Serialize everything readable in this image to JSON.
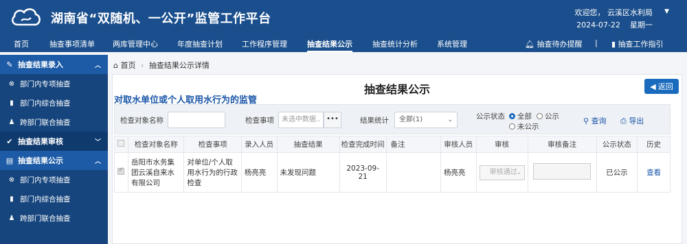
{
  "app": {
    "title": "湖南省“双随机、一公开”监管工作平台"
  },
  "user": {
    "greeting": "欢迎您， 云溪区水利局",
    "date_line": "2024-07-22    星期一"
  },
  "nav": {
    "items": [
      "首页",
      "抽查事项清单",
      "两库管理中心",
      "年度抽查计划",
      "工作程序管理",
      "抽查结果公示",
      "抽查统计分析",
      "系统管理"
    ],
    "right": [
      "抽查待办提醒",
      "抽查工作指引"
    ]
  },
  "sidebar": {
    "groups": [
      {
        "label": "抽查结果录入",
        "items": [
          "部门内专项抽查",
          "部门内综合抽查",
          "跨部门联合抽查"
        ]
      },
      {
        "label": "抽查结果审核"
      },
      {
        "label": "抽查结果公示",
        "items": [
          "部门内专项抽查",
          "部门内综合抽查",
          "跨部门联合抽查"
        ]
      }
    ]
  },
  "breadcrumb": {
    "home": "首页",
    "current": "抽查结果公示详情"
  },
  "page": {
    "title": "抽查结果公示",
    "subtitle": "对取水单位或个人取用水行为的监管",
    "back": "返回"
  },
  "filter": {
    "object_label": "检查对象名称",
    "object_value": "",
    "item_label": "检查事项",
    "item_placeholder": "未选中数据..",
    "item_btn": "•••",
    "stat_label": "结果统计",
    "stat_value": "全部(1)",
    "status_label": "公示状态",
    "status_options": [
      "全部",
      "公示",
      "未公示"
    ],
    "query": "查询",
    "export": "导出"
  },
  "table": {
    "headers": [
      "检查对象名称",
      "检查事项",
      "录入人员",
      "抽查结果",
      "检查完成时间",
      "备注",
      "审核人员",
      "审核",
      "审核备注",
      "公示状态",
      "历史"
    ],
    "rows": [
      {
        "object": "岳阳市水务集团云溪自来水有限公司",
        "item": "对单位/个人取用水行为的行政检查",
        "entry": "杨亮亮",
        "result": "未发现问题",
        "finish": "2023-09-21",
        "remark": "",
        "reviewer": "杨亮亮",
        "review": "审核通过",
        "review_remark": "",
        "status": "已公示",
        "history": "查看"
      }
    ]
  },
  "colors": {
    "header": "#1a4e8c",
    "sidebar": "#16457d",
    "accent": "#1a6bbd"
  }
}
